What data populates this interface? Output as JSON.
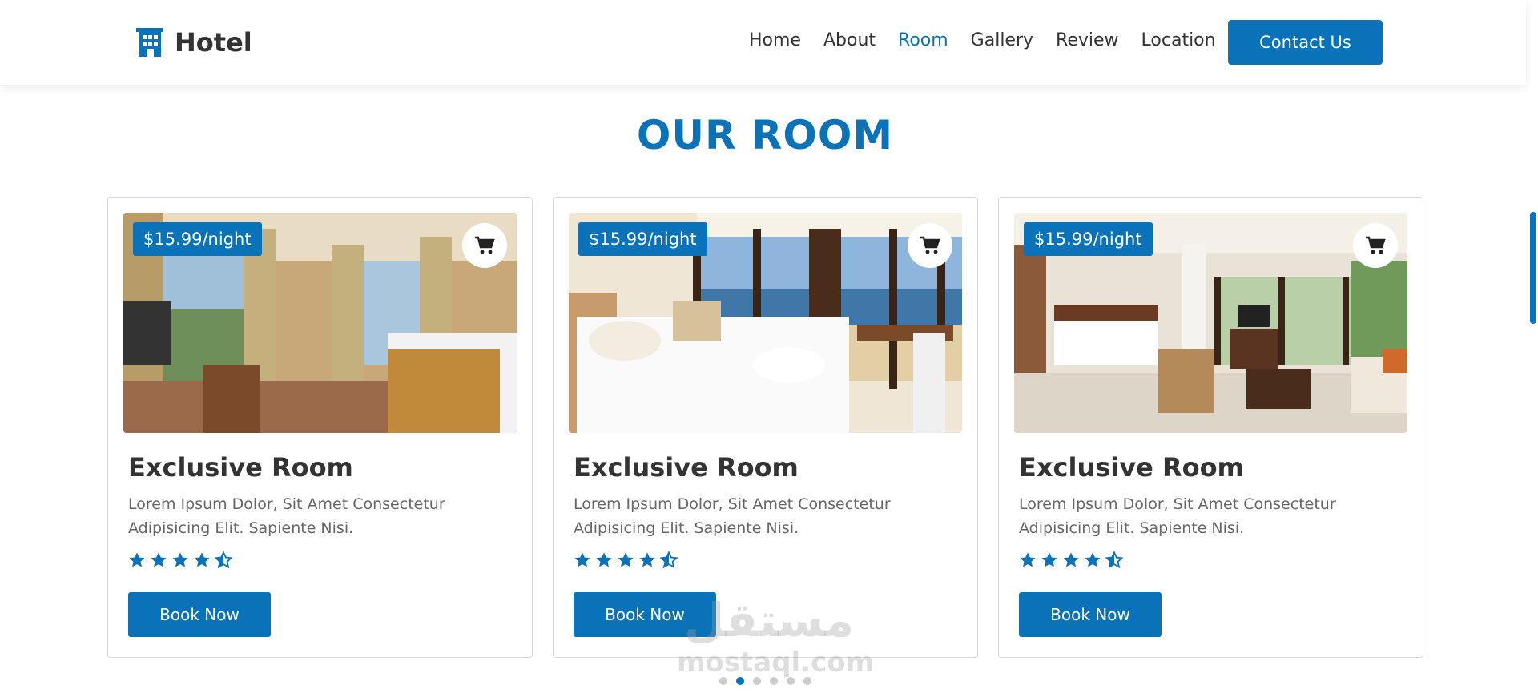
{
  "header": {
    "logo_text": "Hotel",
    "logo_icon": "hotel-building-icon",
    "nav": [
      {
        "label": "Home",
        "active": false
      },
      {
        "label": "About",
        "active": false
      },
      {
        "label": "Room",
        "active": true
      },
      {
        "label": "Gallery",
        "active": false
      },
      {
        "label": "Review",
        "active": false
      },
      {
        "label": "Location",
        "active": false
      }
    ],
    "contact_label": "Contact Us"
  },
  "section": {
    "title": "OUR ROOM"
  },
  "rooms": [
    {
      "price": "$15.99/night",
      "title": "Exclusive Room",
      "description": "Lorem Ipsum Dolor, Sit Amet Consectetur Adipisicing Elit. Sapiente Nisi.",
      "rating": 4.5,
      "book_label": "Book Now",
      "photo": "hotel-room-photo"
    },
    {
      "price": "$15.99/night",
      "title": "Exclusive Room",
      "description": "Lorem Ipsum Dolor, Sit Amet Consectetur Adipisicing Elit. Sapiente Nisi.",
      "rating": 4.5,
      "book_label": "Book Now",
      "photo": "beach-view-room-photo"
    },
    {
      "price": "$15.99/night",
      "title": "Exclusive Room",
      "description": "Lorem Ipsum Dolor, Sit Amet Consectetur Adipisicing Elit. Sapiente Nisi.",
      "rating": 4.5,
      "book_label": "Book Now",
      "photo": "suite-room-photo"
    }
  ],
  "pagination": {
    "count": 6,
    "active": 1
  },
  "watermark": {
    "arabic": "مستقل",
    "latin": "mostaql.com"
  },
  "colors": {
    "accent": "#0a72b8",
    "text": "#333333",
    "muted": "#666666",
    "border": "#d8d8d8"
  }
}
